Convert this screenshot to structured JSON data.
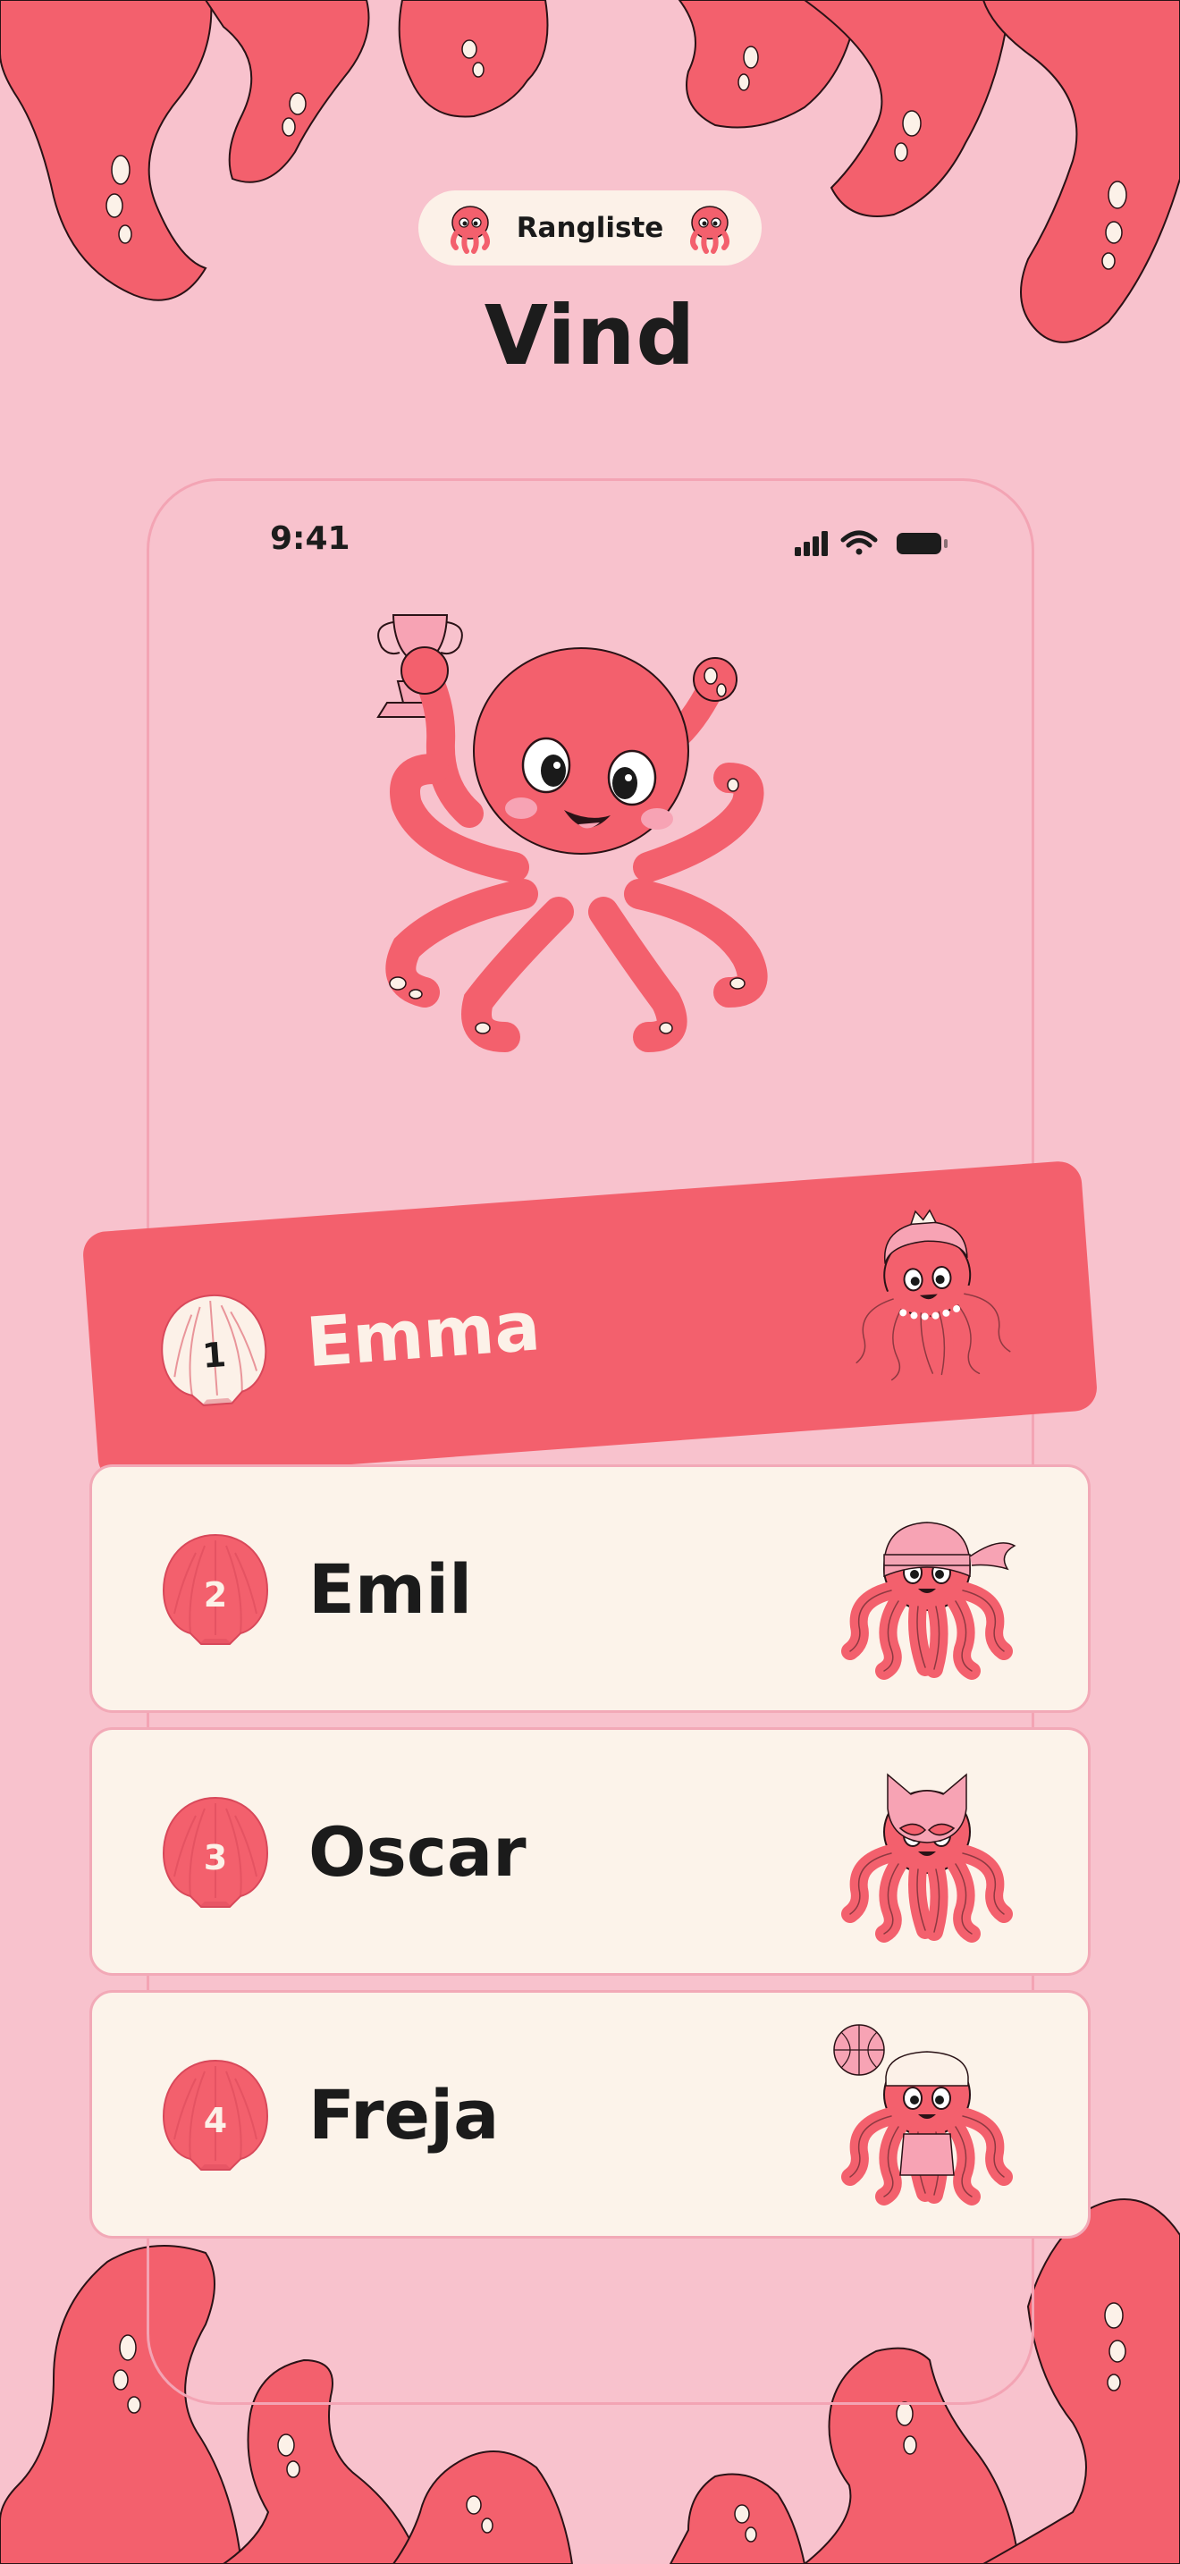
{
  "header": {
    "badge_label": "Rangliste",
    "badge_icons": [
      "octopus-face-icon",
      "octopus-face-icon"
    ],
    "title": "Vind"
  },
  "status_bar": {
    "time": "9:41",
    "icons": [
      "cellular-signal-icon",
      "wifi-icon",
      "battery-icon"
    ]
  },
  "hero": {
    "illustration": "octopus-holding-trophy",
    "trophy_icon": "trophy-icon"
  },
  "leaderboard": [
    {
      "rank": "1",
      "name": "Emma",
      "avatar": "octopus-princess-avatar",
      "highlighted": true
    },
    {
      "rank": "2",
      "name": "Emil",
      "avatar": "octopus-ninja-avatar",
      "highlighted": false
    },
    {
      "rank": "3",
      "name": "Oscar",
      "avatar": "octopus-cat-mask-avatar",
      "highlighted": false
    },
    {
      "rank": "4",
      "name": "Freja",
      "avatar": "octopus-basketball-avatar",
      "highlighted": false
    }
  ],
  "colors": {
    "background": "#f8c2cd",
    "coral": "#f3606d",
    "cream": "#fcf1e8",
    "text": "#1c1c1c",
    "frame_border": "#f3a4b4"
  }
}
